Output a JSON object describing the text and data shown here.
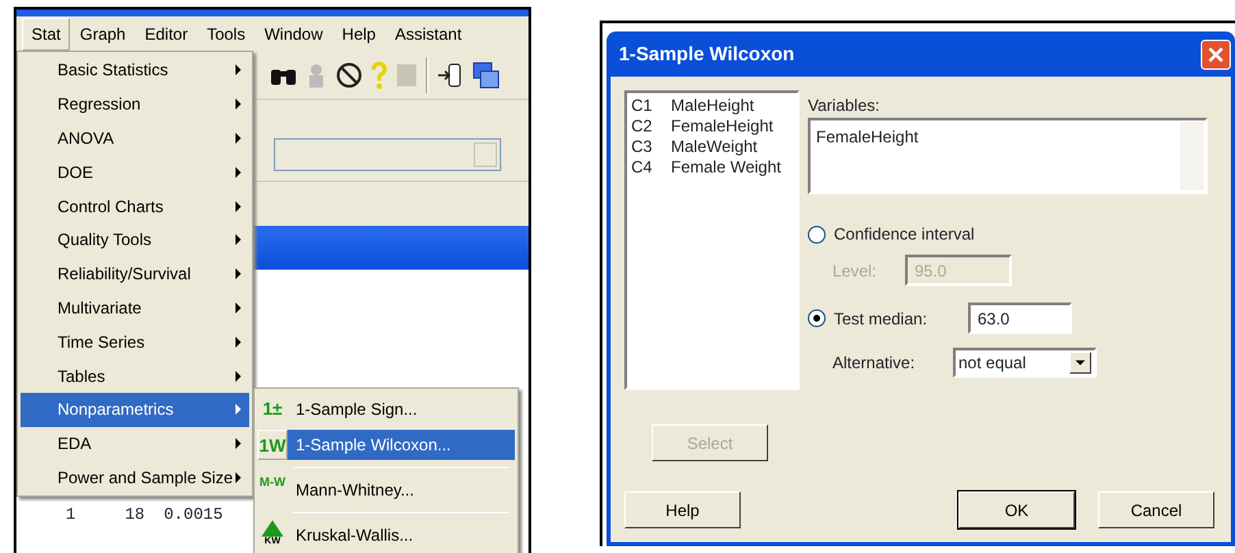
{
  "main_window": {
    "menu_bar": [
      {
        "label": "Stat",
        "selected": true
      },
      {
        "label": "Graph",
        "selected": false
      },
      {
        "label": "Editor",
        "selected": false
      },
      {
        "label": "Tools",
        "selected": false
      },
      {
        "label": "Window",
        "selected": false
      },
      {
        "label": "Help",
        "selected": false
      },
      {
        "label": "Assistant",
        "selected": false
      }
    ],
    "stat_menu": [
      {
        "label": "Basic Statistics",
        "has_submenu": true,
        "selected": false
      },
      {
        "label": "Regression",
        "has_submenu": true,
        "selected": false
      },
      {
        "label": "ANOVA",
        "has_submenu": true,
        "selected": false
      },
      {
        "label": "DOE",
        "has_submenu": true,
        "selected": false
      },
      {
        "label": "Control Charts",
        "has_submenu": true,
        "selected": false
      },
      {
        "label": "Quality Tools",
        "has_submenu": true,
        "selected": false
      },
      {
        "label": "Reliability/Survival",
        "has_submenu": true,
        "selected": false
      },
      {
        "label": "Multivariate",
        "has_submenu": true,
        "selected": false
      },
      {
        "label": "Time Series",
        "has_submenu": true,
        "selected": false
      },
      {
        "label": "Tables",
        "has_submenu": true,
        "selected": false
      },
      {
        "label": "Nonparametrics",
        "has_submenu": true,
        "selected": true
      },
      {
        "label": "EDA",
        "has_submenu": true,
        "selected": false
      },
      {
        "label": "Power and Sample Size",
        "has_submenu": true,
        "selected": false
      }
    ],
    "nonparametrics_submenu": [
      {
        "kind": "sign",
        "icon_text": "1±",
        "label": "1-Sample Sign...",
        "selected": false
      },
      {
        "kind": "wilcoxon",
        "icon_text": "1W",
        "label": "1-Sample Wilcoxon...",
        "selected": true
      },
      {
        "kind": "mann",
        "icon_text": "M-W",
        "label": "Mann-Whitney...",
        "selected": false
      },
      {
        "kind": "kruskal",
        "icon_text": "KW",
        "label": "Kruskal-Wallis...",
        "selected": false
      }
    ],
    "worksheet_row": [
      "1",
      "18",
      "0.0015"
    ]
  },
  "dialog": {
    "title": "1-Sample Wilcoxon",
    "columns": [
      {
        "id": "C1",
        "name": "MaleHeight"
      },
      {
        "id": "C2",
        "name": "FemaleHeight"
      },
      {
        "id": "C3",
        "name": "MaleWeight"
      },
      {
        "id": "C4",
        "name": "Female Weight"
      }
    ],
    "variables_label": "Variables:",
    "variables_value": "FemaleHeight",
    "confidence_interval": {
      "label": "Confidence interval",
      "selected": false,
      "level_label": "Level:",
      "level_value": "95.0",
      "disabled": true
    },
    "test_median": {
      "label": "Test median:",
      "selected": true,
      "value": "63.0"
    },
    "alternative": {
      "label": "Alternative:",
      "value": "not equal"
    },
    "select_button": {
      "label": "Select",
      "disabled": true
    },
    "buttons": [
      {
        "label": "Help",
        "default": false
      },
      {
        "label": "OK",
        "default": true
      },
      {
        "label": "Cancel",
        "default": false
      }
    ]
  }
}
